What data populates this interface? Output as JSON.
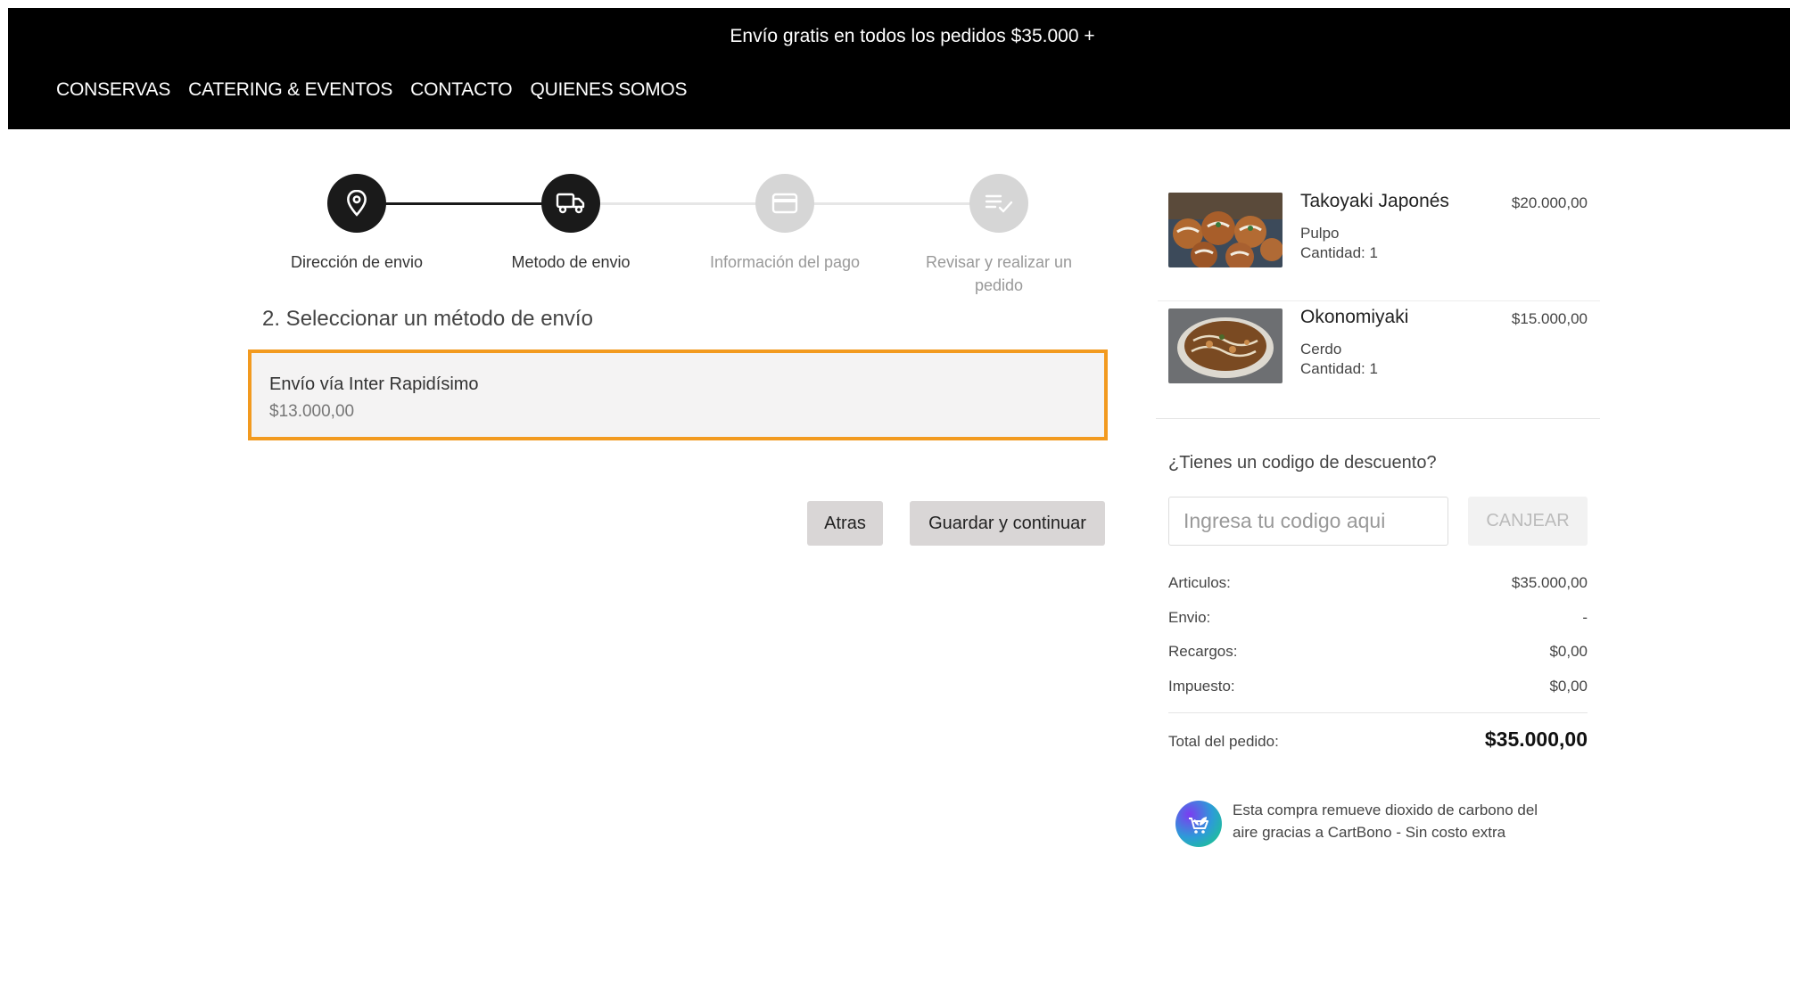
{
  "header": {
    "promo": "Envío gratis en todos los pedidos $35.000 +",
    "nav": [
      "CONSERVAS",
      "CATERING & EVENTOS",
      "CONTACTO",
      "QUIENES SOMOS"
    ]
  },
  "steps": [
    {
      "label": "Dirección de envio",
      "icon": "map-pin-icon",
      "state": "done"
    },
    {
      "label": "Metodo de envio",
      "icon": "truck-icon",
      "state": "current"
    },
    {
      "label": "Información del pago",
      "icon": "credit-card-icon",
      "state": "todo"
    },
    {
      "label": "Revisar y realizar un pedido",
      "icon": "checklist-icon",
      "state": "todo"
    }
  ],
  "shipping": {
    "title": "2. Seleccionar un método de envío",
    "option_name": "Envío vía Inter Rapidísimo",
    "option_price": "$13.000,00"
  },
  "actions": {
    "back": "Atras",
    "save": "Guardar y continuar"
  },
  "cart": {
    "items": [
      {
        "name": "Takoyaki Japonés",
        "variant": "Pulpo",
        "quantity": "Cantidad: 1",
        "price": "$20.000,00"
      },
      {
        "name": "Okonomiyaki",
        "variant": "Cerdo",
        "quantity": "Cantidad: 1",
        "price": "$15.000,00"
      }
    ],
    "discount_question": "¿Tienes un codigo de descuento?",
    "discount_placeholder": "Ingresa tu codigo aqui",
    "redeem_label": "CANJEAR",
    "totals": [
      {
        "label": "Articulos:",
        "value": "$35.000,00"
      },
      {
        "label": "Envio:",
        "value": "-"
      },
      {
        "label": "Recargos:",
        "value": "$0,00"
      },
      {
        "label": "Impuesto:",
        "value": "$0,00"
      }
    ],
    "order_total_label": "Total del pedido:",
    "order_total_value": "$35.000,00",
    "carbon_text": "Esta compra remueve dioxido de carbono del aire gracias a CartBono - Sin costo extra"
  },
  "colors": {
    "accent_border": "#f29a1f",
    "step_done": "#1a1a1a",
    "step_todo": "#d6d6d6"
  }
}
